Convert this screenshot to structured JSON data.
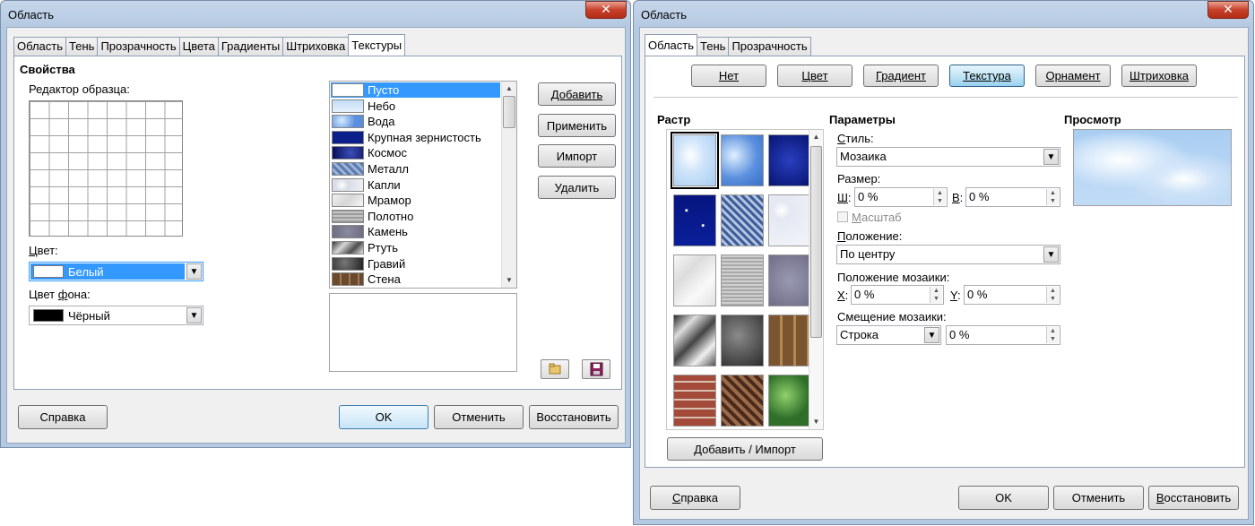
{
  "left": {
    "title": "Область",
    "tabs": [
      "Область",
      "Тень",
      "Прозрачность",
      "Цвета",
      "Градиенты",
      "Штриховка",
      "Текстуры"
    ],
    "active_tab": "Текстуры",
    "section_title": "Свойства",
    "pattern_editor_label": "Редактор образца:",
    "color_label": "Цвет:",
    "color_value": "Белый",
    "bg_color_label": "Цвет фона:",
    "bg_color_value": "Чёрный",
    "textures": [
      {
        "name": "Пусто",
        "selected": true
      },
      {
        "name": "Небо"
      },
      {
        "name": "Вода"
      },
      {
        "name": "Крупная зернистость"
      },
      {
        "name": "Космос"
      },
      {
        "name": "Металл"
      },
      {
        "name": "Капли"
      },
      {
        "name": "Мрамор"
      },
      {
        "name": "Полотно"
      },
      {
        "name": "Камень"
      },
      {
        "name": "Ртуть"
      },
      {
        "name": "Гравий"
      },
      {
        "name": "Стена"
      }
    ],
    "buttons": {
      "add": "Добавить",
      "apply": "Применить",
      "import": "Импорт",
      "delete": "Удалить",
      "help": "Справка",
      "ok": "OK",
      "cancel": "Отменить",
      "reset": "Восстановить"
    }
  },
  "right": {
    "title": "Область",
    "tabs": [
      "Область",
      "Тень",
      "Прозрачность"
    ],
    "active_tab": "Область",
    "fill_types": [
      "Нет",
      "Цвет",
      "Градиент",
      "Текстура",
      "Орнамент",
      "Штриховка"
    ],
    "active_fill": "Текстура",
    "raster_label": "Растр",
    "raster_tiles": [
      "sky",
      "water",
      "coarse-grain",
      "space",
      "metal",
      "drops",
      "marble",
      "linen",
      "stone",
      "mercury",
      "gravel",
      "wall",
      "brick",
      "weave",
      "leaves"
    ],
    "add_import_button": "Добавить / Импорт",
    "params_label": "Параметры",
    "style_label": "Стиль:",
    "style_value": "Мозаика",
    "size_label": "Размер:",
    "width_label": "Ш:",
    "width_value": "0 %",
    "height_label": "В:",
    "height_value": "0 %",
    "scale_label": "Масштаб",
    "position_label": "Положение:",
    "position_value": "По центру",
    "tile_position_label": "Положение мозаики:",
    "x_label": "X:",
    "x_value": "0 %",
    "y_label": "Y:",
    "y_value": "0 %",
    "tile_offset_label": "Смещение мозаики:",
    "offset_type_value": "Строка",
    "offset_value": "0 %",
    "preview_label": "Просмотр",
    "buttons": {
      "help": "Справка",
      "ok": "OK",
      "cancel": "Отменить",
      "reset": "Восстановить"
    }
  }
}
